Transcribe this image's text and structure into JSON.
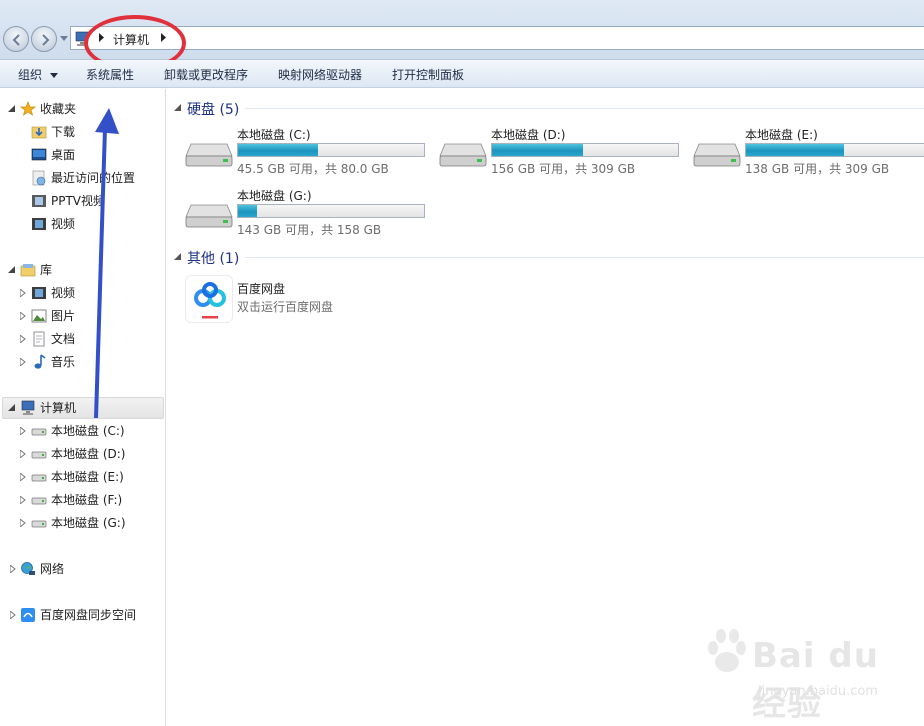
{
  "address": {
    "location": "计算机"
  },
  "toolbar": {
    "organize": "组织",
    "system_properties": "系统属性",
    "uninstall": "卸载或更改程序",
    "map_drive": "映射网络驱动器",
    "control_panel": "打开控制面板"
  },
  "sidebar": {
    "favorites": "收藏夹",
    "fav_items": [
      "下载",
      "桌面",
      "最近访问的位置",
      "PPTV视频",
      "视频"
    ],
    "libraries": "库",
    "lib_items": [
      "视频",
      "图片",
      "文档",
      "音乐"
    ],
    "computer": "计算机",
    "computer_items": [
      "本地磁盘 (C:)",
      "本地磁盘 (D:)",
      "本地磁盘 (E:)",
      "本地磁盘 (F:)",
      "本地磁盘 (G:)"
    ],
    "network": "网络",
    "baidu_sync": "百度网盘同步空间"
  },
  "main": {
    "hard_drives_header": "硬盘 (5)",
    "drives": [
      {
        "name": "本地磁盘 (C:)",
        "info": "45.5 GB 可用，共 80.0 GB",
        "used_fraction": 0.43
      },
      {
        "name": "本地磁盘 (D:)",
        "info": "156 GB 可用，共 309 GB",
        "used_fraction": 0.49
      },
      {
        "name": "本地磁盘 (E:)",
        "info": "138 GB 可用，共 309 GB",
        "used_fraction": 0.55
      },
      {
        "name": "本地磁盘 (G:)",
        "info": "143 GB 可用，共 158 GB",
        "used_fraction": 0.1
      }
    ],
    "other_header": "其他 (1)",
    "app": {
      "name": "百度网盘",
      "desc": "双击运行百度网盘"
    }
  },
  "watermark": {
    "text": "Bai du 经验",
    "sub": "jingyan.baidu.com"
  },
  "colors": {
    "accent_annotation_red": "#e0303c",
    "annotation_arrow_blue": "#3450c8",
    "drive_fill": "#1d95bf",
    "group_header": "#1e3287"
  }
}
